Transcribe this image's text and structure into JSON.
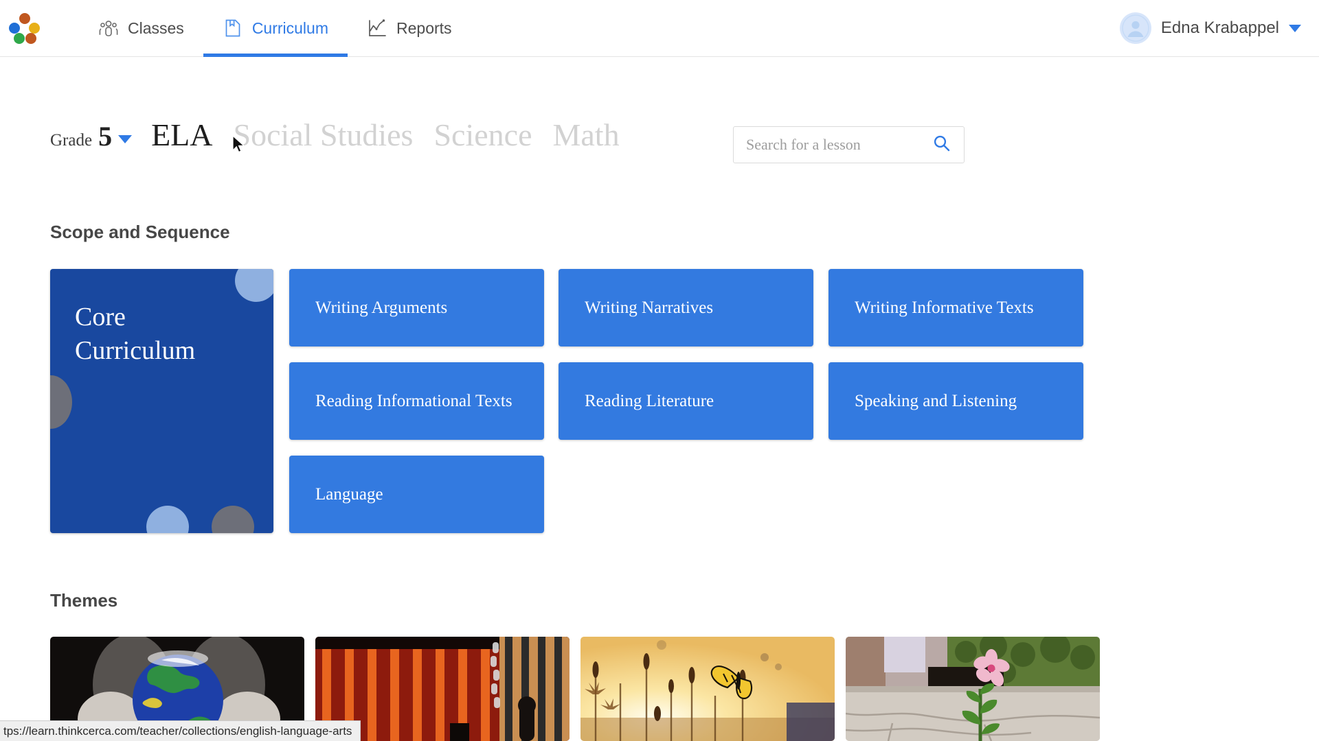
{
  "nav": {
    "logo_name": "thinkcerca-logo",
    "tabs": [
      {
        "label": "Classes",
        "icon": "people-group-icon",
        "active": false
      },
      {
        "label": "Curriculum",
        "icon": "bookmark-document-icon",
        "active": true
      },
      {
        "label": "Reports",
        "icon": "line-chart-icon",
        "active": false
      }
    ],
    "user": {
      "name": "Edna Krabappel",
      "avatar_icon": "user-avatar-icon",
      "caret_icon": "chevron-down-icon"
    }
  },
  "subject_bar": {
    "grade_label": "Grade",
    "grade_value": "5",
    "grade_caret_icon": "chevron-down-icon",
    "subjects": [
      {
        "label": "ELA",
        "active": true
      },
      {
        "label": "Social Studies",
        "active": false
      },
      {
        "label": "Science",
        "active": false
      },
      {
        "label": "Math",
        "active": false
      }
    ]
  },
  "search": {
    "placeholder": "Search for a lesson",
    "value": "",
    "icon": "search-icon"
  },
  "scope": {
    "title": "Scope and Sequence",
    "core_card": {
      "line1": "Core",
      "line2": "Curriculum"
    },
    "tiles": [
      {
        "label": "Writing Arguments",
        "col": 0,
        "row": 0
      },
      {
        "label": "Writing Narratives",
        "col": 1,
        "row": 0
      },
      {
        "label": "Writing Informative Texts",
        "col": 2,
        "row": 0
      },
      {
        "label": "Reading Informational Texts",
        "col": 0,
        "row": 1
      },
      {
        "label": "Reading Literature",
        "col": 1,
        "row": 1
      },
      {
        "label": "Speaking and Listening",
        "col": 2,
        "row": 1
      },
      {
        "label": "Language",
        "col": 0,
        "row": 2
      }
    ]
  },
  "themes": {
    "title": "Themes",
    "cards": [
      {
        "image_name": "hands-holding-globe-image"
      },
      {
        "image_name": "red-prison-bars-chain-image"
      },
      {
        "image_name": "butterfly-sunset-field-image"
      },
      {
        "image_name": "pink-flower-in-concrete-image"
      }
    ]
  },
  "status_bar": {
    "url": "tps://learn.thinkcerca.com/teacher/collections/english-language-arts"
  },
  "colors": {
    "accent_blue": "#2f7ae5",
    "tile_blue": "#337ae0",
    "core_card_blue": "#19489f",
    "text_dark": "#3d3d3d",
    "text_muted": "#d2d2d2"
  }
}
